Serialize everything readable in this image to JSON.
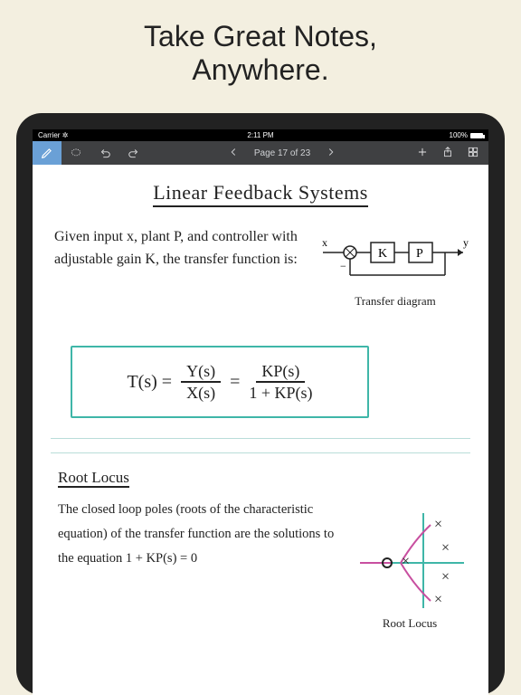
{
  "promo": {
    "line1": "Take Great Notes,",
    "line2": "Anywhere."
  },
  "status": {
    "carrier": "Carrier",
    "time": "2:11 PM",
    "battery": "100%"
  },
  "toolbar": {
    "page_label": "Page 17 of 23"
  },
  "note": {
    "title": "Linear Feedback Systems",
    "intro": "Given input x, plant P, and controller with adjustable gain K, the transfer function is:",
    "diagram_caption": "Transfer diagram",
    "eq_lhs": "T(s) =",
    "eq_frac1_num": "Y(s)",
    "eq_frac1_den": "X(s)",
    "eq_sep": "=",
    "eq_frac2_num": "KP(s)",
    "eq_frac2_den": "1 + KP(s)",
    "subheading": "Root Locus",
    "body": "The closed loop poles (roots of the characteristic equation) of the transfer function are the solutions to the equation  1 + KP(s) = 0",
    "root_caption": "Root Locus"
  },
  "diagram": {
    "in": "x",
    "k": "K",
    "p": "P",
    "out": "y"
  }
}
